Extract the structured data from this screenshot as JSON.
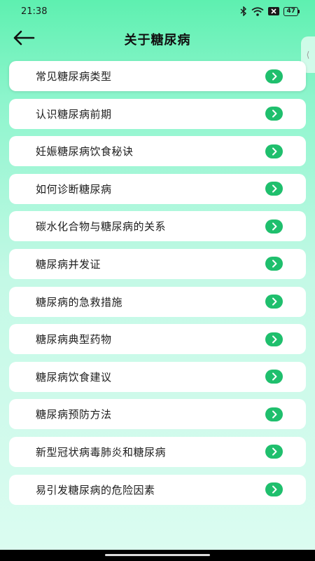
{
  "status_bar": {
    "time": "21:38",
    "battery": "47",
    "icons": [
      "bluetooth-icon",
      "wifi-icon",
      "sim-x-icon",
      "battery-icon"
    ]
  },
  "header": {
    "title": "关于糖尿病",
    "back_icon": "arrow-left-icon"
  },
  "side_handle": {
    "glyph": "⟨"
  },
  "list": {
    "items": [
      {
        "label": "常见糖尿病类型"
      },
      {
        "label": "认识糖尿病前期"
      },
      {
        "label": "妊娠糖尿病饮食秘诀"
      },
      {
        "label": "如何诊断糖尿病"
      },
      {
        "label": "碳水化合物与糖尿病的关系"
      },
      {
        "label": "糖尿病并发证"
      },
      {
        "label": "糖尿病的急救措施"
      },
      {
        "label": "糖尿病典型药物"
      },
      {
        "label": "糖尿病饮食建议"
      },
      {
        "label": "糖尿病预防方法"
      },
      {
        "label": "新型冠状病毒肺炎和糖尿病"
      },
      {
        "label": "易引发糖尿病的危险因素"
      }
    ],
    "item_icon": "chevron-right-icon"
  },
  "colors": {
    "accent": "#1fbf6d",
    "gradient_top": "#5ef0b0",
    "gradient_bottom": "#dcfcf1"
  }
}
